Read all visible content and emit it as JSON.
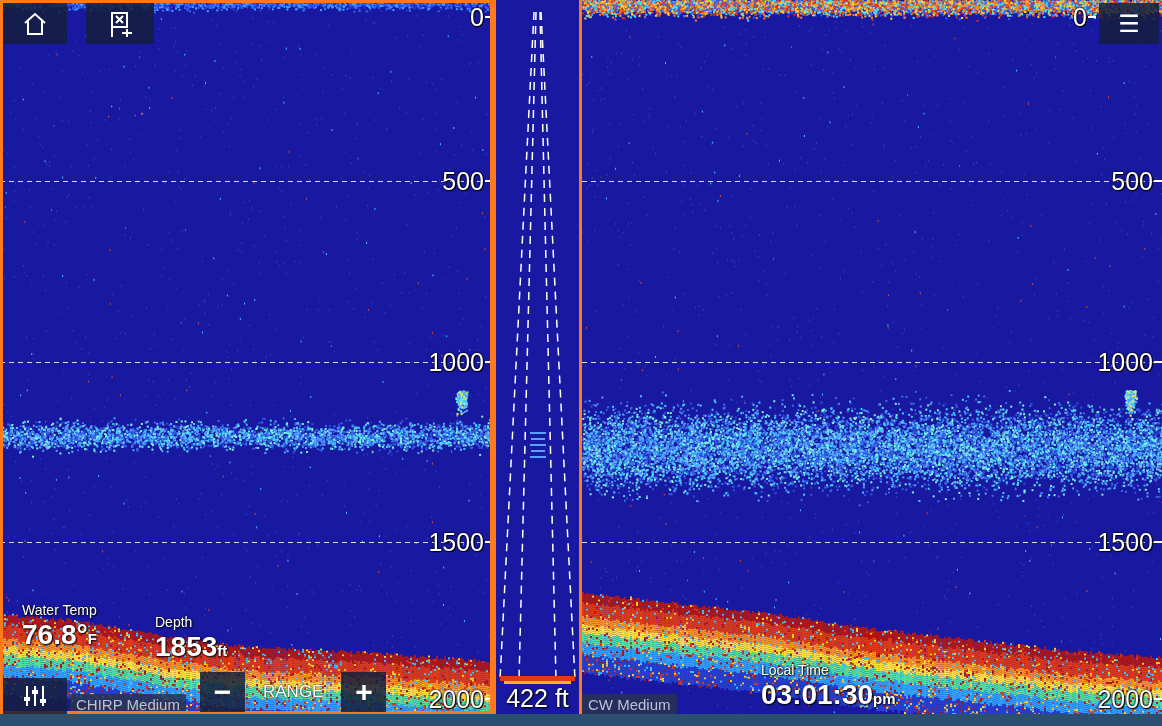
{
  "top_bar": {
    "menu": "☰"
  },
  "panels": [
    {
      "mode": "CHIRP Medium",
      "selected": true,
      "scale": [
        "0",
        "500",
        "1000",
        "1500",
        "2000"
      ],
      "bottom_ft": [
        1700,
        1720,
        1760,
        1790,
        1800,
        1815,
        1830
      ],
      "layer_ft": [
        1150,
        1260
      ],
      "target_ft": 1080
    },
    {
      "mode": "CW Medium",
      "selected": false,
      "scale": [
        "0",
        "500",
        "1000",
        "1500",
        "2000"
      ],
      "bottom_ft": [
        1640,
        1670,
        1700,
        1740,
        1770,
        1800,
        1820
      ],
      "layer_ft": [
        1080,
        1400
      ],
      "target_ft": 1080
    }
  ],
  "zoom_bar": {
    "range": "422 ft"
  },
  "readouts": [
    {
      "label": "Water Temp",
      "value": "76.8°",
      "unit": "F"
    },
    {
      "label": "Depth",
      "value": "1853",
      "unit": "ft"
    }
  ],
  "range_control": {
    "minus": "−",
    "label": "RANGE",
    "plus": "+"
  },
  "clock": {
    "label": "Local Time",
    "value": "03:01:30",
    "unit": "pm"
  }
}
